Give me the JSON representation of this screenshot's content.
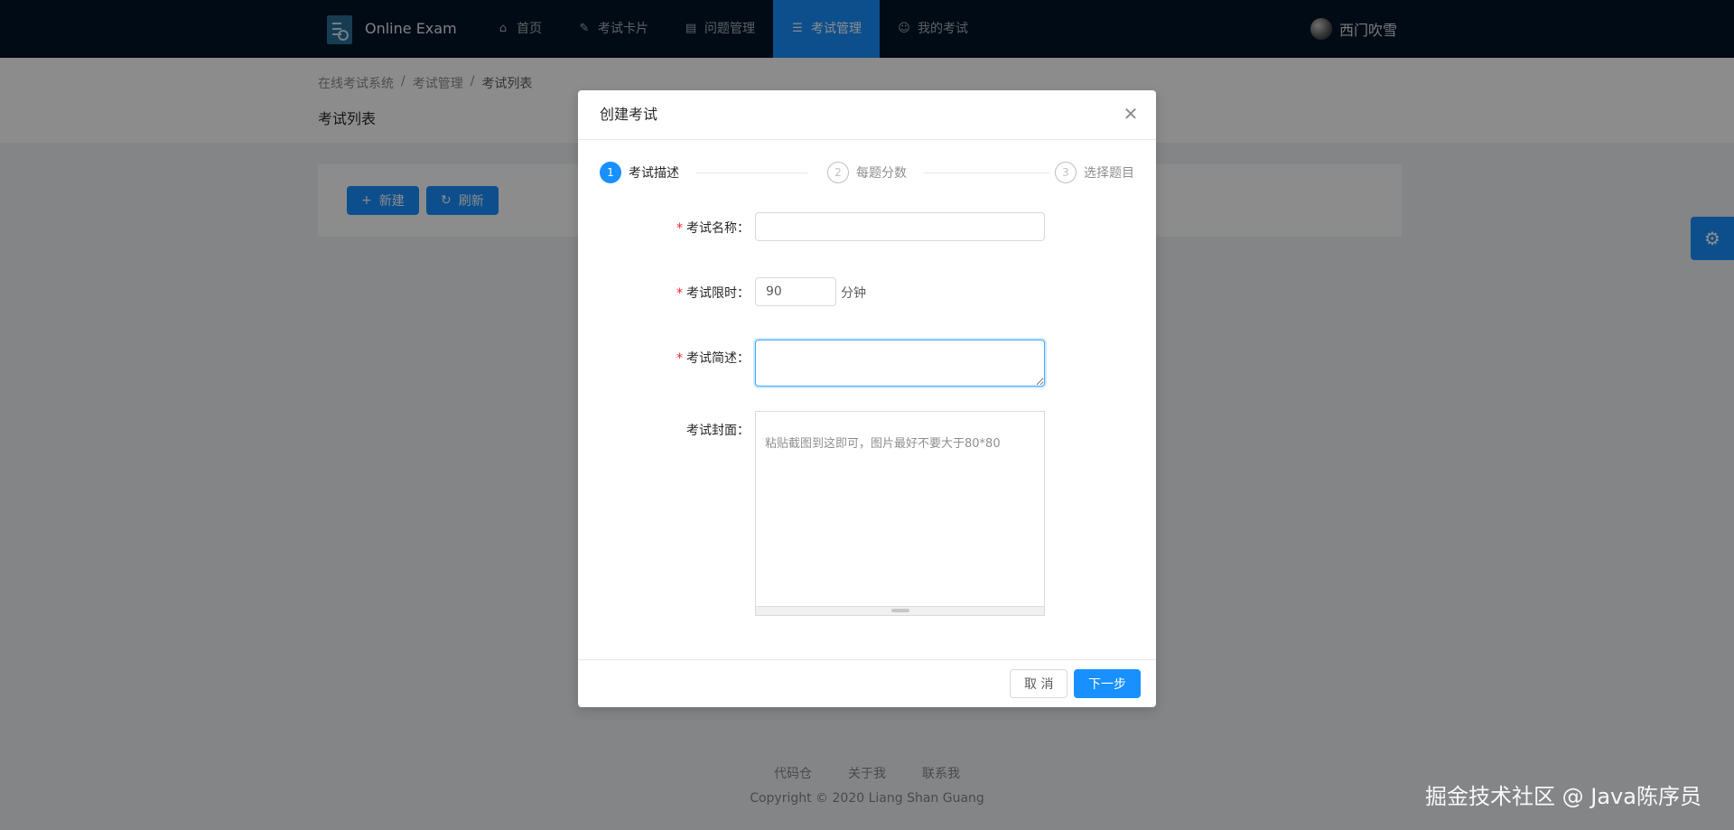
{
  "header": {
    "brand": "Online Exam",
    "nav": [
      {
        "label": "首页",
        "icon": "home-icon",
        "glyph": "⌂"
      },
      {
        "label": "考试卡片",
        "icon": "thumb-icon",
        "glyph": "✎"
      },
      {
        "label": "问题管理",
        "icon": "book-icon",
        "glyph": "▤"
      },
      {
        "label": "考试管理",
        "icon": "team-icon",
        "glyph": "☰"
      },
      {
        "label": "我的考试",
        "icon": "user-icon",
        "glyph": "☺"
      }
    ],
    "active_nav": "考试管理",
    "user_name": "西门吹雪"
  },
  "page": {
    "breadcrumb": [
      "在线考试系统",
      "考试管理",
      "考试列表"
    ],
    "title": "考试列表",
    "new_label": "新建",
    "refresh_label": "刷新"
  },
  "footer": {
    "links": [
      "代码仓",
      "关于我",
      "联系我"
    ],
    "copyright": "Copyright © 2020 Liang Shan Guang"
  },
  "modal": {
    "title": "创建考试",
    "close_glyph": "✕",
    "steps": [
      {
        "num": "1",
        "title": "考试描述"
      },
      {
        "num": "2",
        "title": "每题分数"
      },
      {
        "num": "3",
        "title": "选择题目"
      }
    ],
    "active_step": 0,
    "form": {
      "name_label": "考试名称：",
      "name_value": "",
      "time_label": "考试限时：",
      "time_value": "90",
      "time_unit": "分钟",
      "desc_label": "考试简述：",
      "desc_value": "",
      "cover_label": "考试封面：",
      "cover_placeholder": "粘贴截图到这即可，图片最好不要大于80*80"
    },
    "cancel_label": "取 消",
    "next_label": "下一步"
  },
  "watermark": "掘金技术社区 @ Java陈序员",
  "colors": {
    "primary": "#1890ff",
    "header_bg": "#001529",
    "required": "#f5222d"
  }
}
